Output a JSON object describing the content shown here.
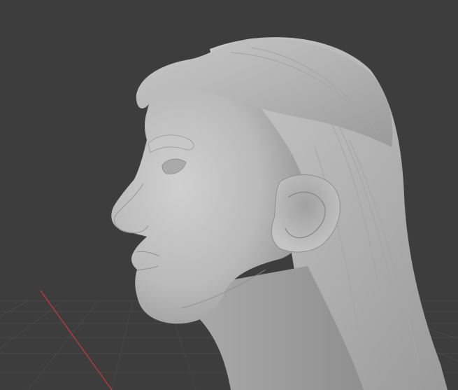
{
  "viewport": {
    "background_color": "#3d3d3d",
    "grid_color": "#4a4a4a",
    "x_axis_color": "#b03a3a",
    "sculpt_color": "#b8b8b8"
  },
  "scene": {
    "object_name": "head-bust-sculpt",
    "view": "side-profile-left"
  }
}
